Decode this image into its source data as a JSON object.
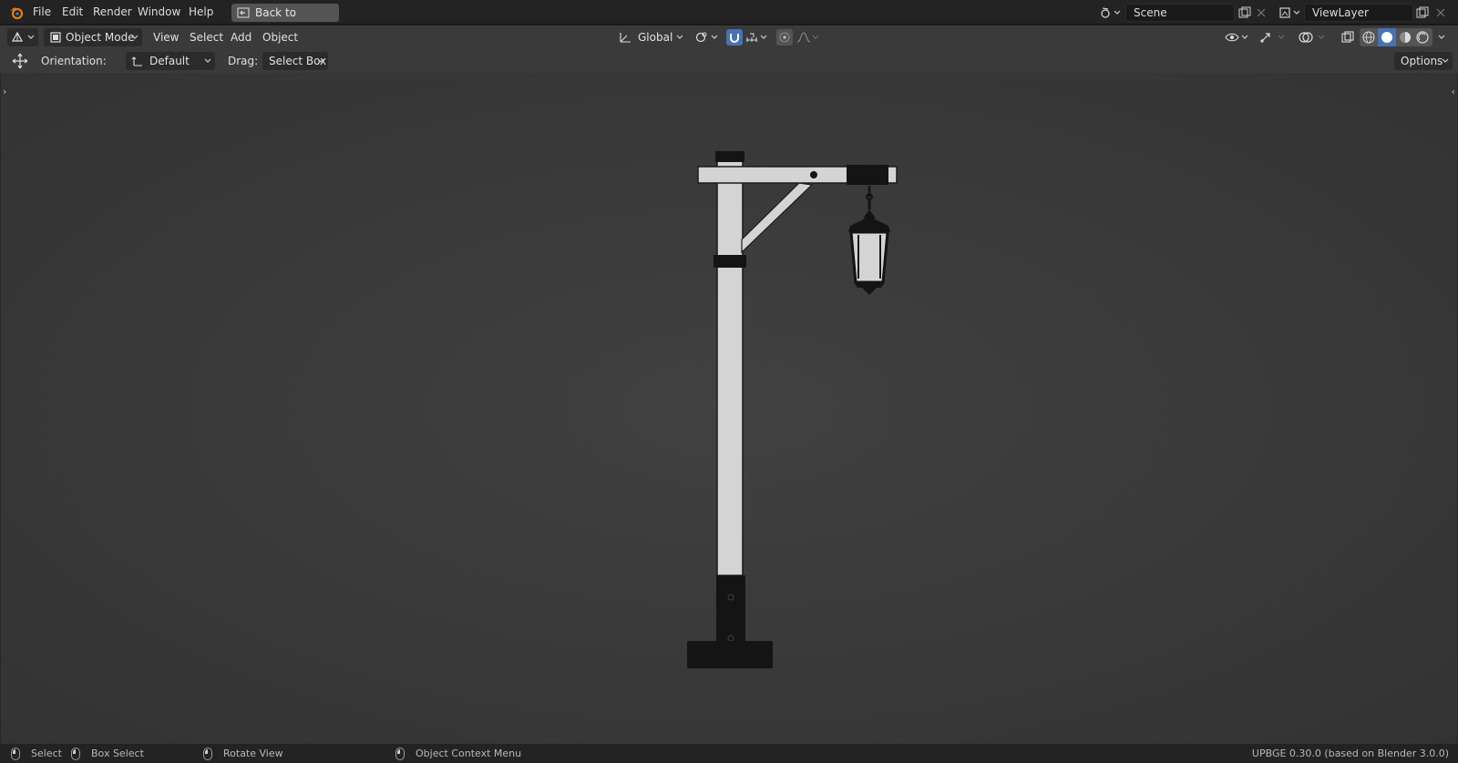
{
  "menu": {
    "items": [
      "File",
      "Edit",
      "Render",
      "Window",
      "Help"
    ],
    "back_button": "Back to Previous"
  },
  "scene": {
    "label": "Scene"
  },
  "view_layer": {
    "label": "ViewLayer"
  },
  "header": {
    "mode": "Object Mode",
    "menus": [
      "View",
      "Select",
      "Add",
      "Object"
    ],
    "transform_orientation": "Global",
    "orientation_label": "Orientation:",
    "orientation_value": "Default",
    "drag_label": "Drag:",
    "drag_value": "Select Box",
    "options_label": "Options"
  },
  "statusbar": {
    "select": "Select",
    "box_select": "Box Select",
    "rotate_view": "Rotate View",
    "context_menu": "Object Context Menu",
    "version": "UPBGE 0.30.0 (based on Blender 3.0.0)"
  },
  "colors": {
    "accent_blue": "#4772b3",
    "viewport_bg": "#3b3b3b",
    "object_white": "#d4d4d4",
    "object_black": "#141414"
  }
}
